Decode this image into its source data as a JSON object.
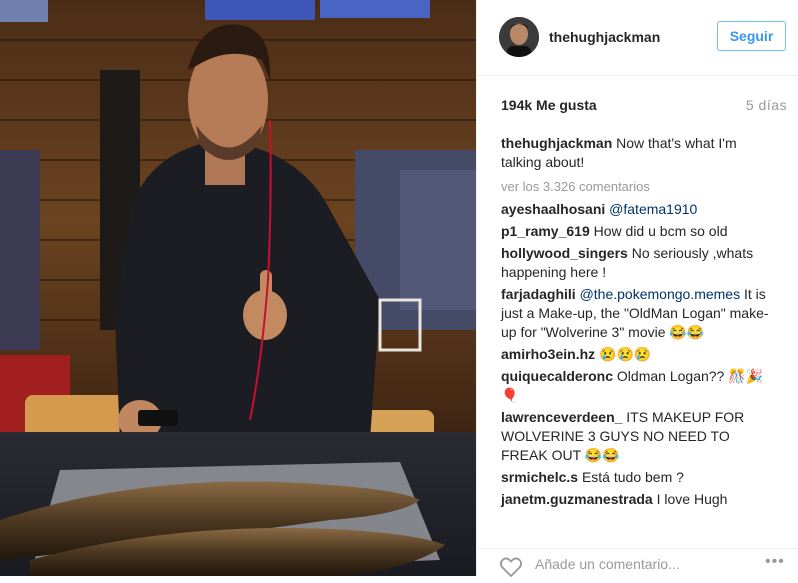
{
  "post": {
    "username": "thehughjackman",
    "follow_label": "Seguir",
    "likes": "194k Me gusta",
    "time_ago": "5 días",
    "caption_user": "thehughjackman",
    "caption_text": "Now that's what I'm talking about!",
    "view_all": "ver los 3.326 comentarios"
  },
  "comments": [
    {
      "user": "ayeshaalhosani",
      "mention": "@fatema1910",
      "text": ""
    },
    {
      "user": "p1_ramy_619",
      "mention": "",
      "text": "How did u bcm so old"
    },
    {
      "user": "hollywood_singers",
      "mention": "",
      "text": "No seriously ,whats happening here !"
    },
    {
      "user": "farjadaghili",
      "mention": "@the.pokemongo.memes",
      "text": "It is just a Make-up, the \"OldMan Logan\" make-up for \"Wolverine 3\" movie 😂😂"
    },
    {
      "user": "amirho3ein.hz",
      "mention": "",
      "text": "😢😢😢"
    },
    {
      "user": "quiquecalderonc",
      "mention": "",
      "text": "Oldman Logan?? 🎊🎉🎈"
    },
    {
      "user": "lawrenceverdeen_",
      "mention": "",
      "text": "ITS MAKEUP FOR WOLVERINE 3 GUYS NO NEED TO FREAK OUT 😂😂"
    },
    {
      "user": "srmichelc.s",
      "mention": "",
      "text": "Está tudo bem ?"
    },
    {
      "user": "janetm.guzmanestrada",
      "mention": "",
      "text": "I love Hugh"
    }
  ],
  "footer": {
    "placeholder": "Añade un comentario...",
    "more_label": "•••",
    "heart_icon": "heart-outline-icon"
  },
  "colors": {
    "link": "#003569",
    "follow": "#3897f0",
    "muted": "#999999"
  }
}
